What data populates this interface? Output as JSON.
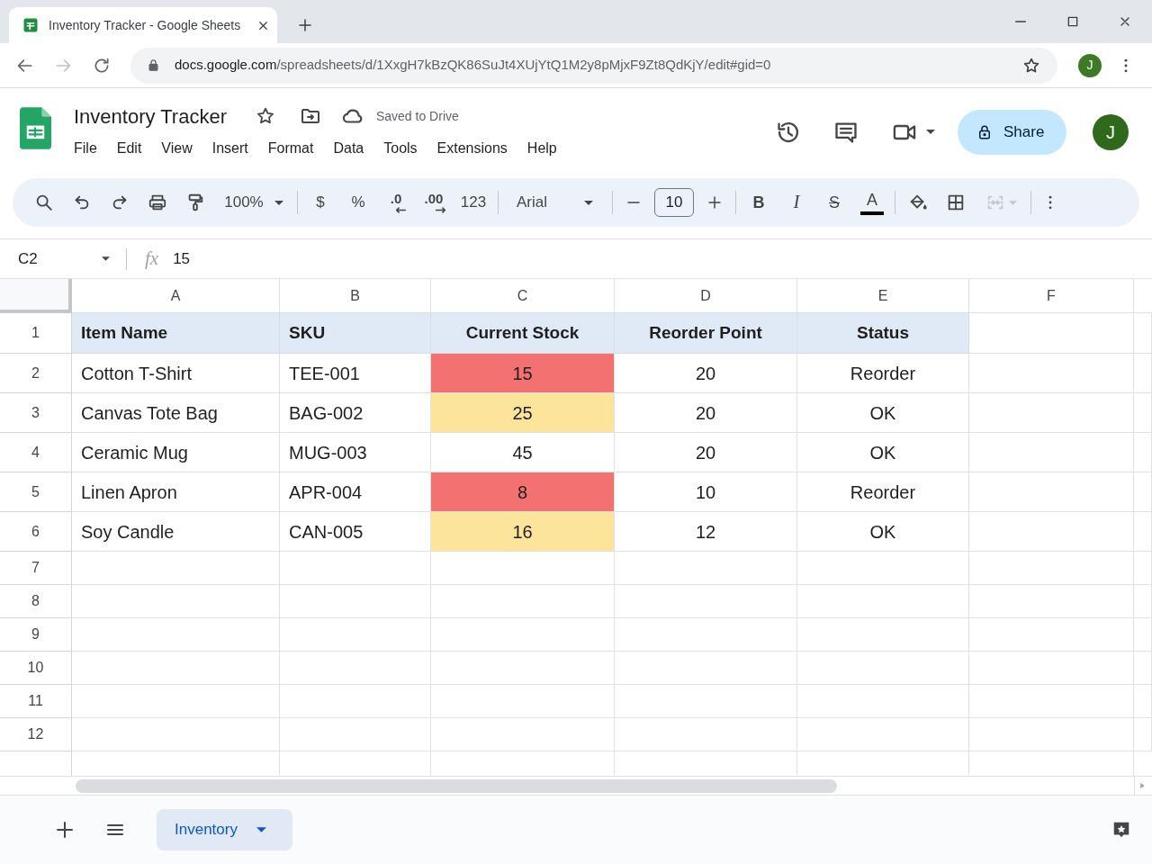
{
  "browser": {
    "tab_title": "Inventory Tracker - Google Sheets",
    "url_host": "docs.google.com",
    "url_path": "/spreadsheets/d/1XxgH7kBzQK86SuJt4XUjYtQ1M2y8pMjxF9Zt8QdKjY/edit#gid=0",
    "forward": {
      "disabled": true
    },
    "profile_initial": "J"
  },
  "document": {
    "title": "Inventory Tracker",
    "save_status": "Saved to Drive",
    "menu": [
      "File",
      "Edit",
      "View",
      "Insert",
      "Format",
      "Data",
      "Tools",
      "Extensions",
      "Help"
    ],
    "share_label": "Share",
    "account_initial": "J"
  },
  "toolbar": {
    "zoom": "100%",
    "currency": "$",
    "percent": "%",
    "decrease_decimal": ".0",
    "increase_decimal": ".00",
    "number_format": "123",
    "font": "Arial",
    "font_size": "10",
    "bold": "B",
    "italic": "I",
    "strikethrough": "S",
    "text_color": "A",
    "merge": {
      "disabled": true
    }
  },
  "formula_bar": {
    "cell_reference": "C2",
    "function_label": "fx",
    "value": "15"
  },
  "sheet": {
    "columns": [
      "A",
      "B",
      "C",
      "D",
      "E",
      "F"
    ],
    "header_row": {
      "number": "1",
      "cells": [
        "Item Name",
        "SKU",
        "Current Stock",
        "Reorder Point",
        "Status"
      ]
    },
    "rows": [
      {
        "number": "2",
        "cells": [
          {
            "text": "Cotton T-Shirt"
          },
          {
            "text": "TEE-001"
          },
          {
            "text": "15",
            "color": "#f47171"
          },
          {
            "text": "20"
          },
          {
            "text": "Reorder"
          }
        ]
      },
      {
        "number": "3",
        "cells": [
          {
            "text": "Canvas Tote Bag"
          },
          {
            "text": "BAG-002"
          },
          {
            "text": "25",
            "color": "#fde49b"
          },
          {
            "text": "20"
          },
          {
            "text": "OK"
          }
        ]
      },
      {
        "number": "4",
        "cells": [
          {
            "text": "Ceramic Mug"
          },
          {
            "text": "MUG-003"
          },
          {
            "text": "45"
          },
          {
            "text": "20"
          },
          {
            "text": "OK"
          }
        ]
      },
      {
        "number": "5",
        "cells": [
          {
            "text": "Linen Apron"
          },
          {
            "text": "APR-004"
          },
          {
            "text": "8",
            "color": "#f47171"
          },
          {
            "text": "10"
          },
          {
            "text": "Reorder"
          }
        ]
      },
      {
        "number": "6",
        "cells": [
          {
            "text": "Soy Candle"
          },
          {
            "text": "CAN-005"
          },
          {
            "text": "16",
            "color": "#fde49b"
          },
          {
            "text": "12"
          },
          {
            "text": "OK"
          }
        ]
      }
    ],
    "empty_rows": [
      "7",
      "8",
      "9",
      "10",
      "11",
      "12"
    ]
  },
  "sheet_tabs": [
    {
      "label": "Inventory",
      "selected": true
    }
  ]
}
